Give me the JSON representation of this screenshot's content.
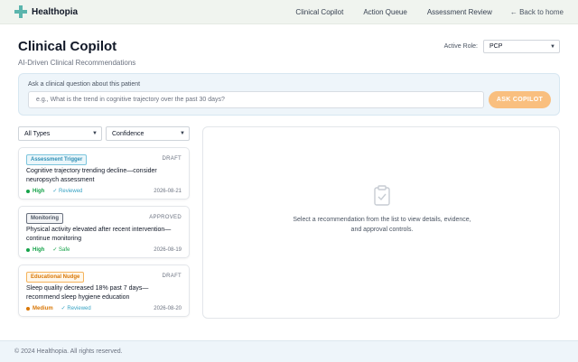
{
  "app": {
    "name": "Healthopia"
  },
  "nav": {
    "links": [
      "Clinical Copilot",
      "Action Queue",
      "Assessment Review"
    ],
    "back_label": "← Back to home"
  },
  "header": {
    "title": "Clinical Copilot",
    "subtitle": "AI-Driven Clinical Recommendations"
  },
  "role": {
    "label": "Active Role:",
    "value": "PCP"
  },
  "ask": {
    "label": "Ask a clinical question about this patient",
    "placeholder": "e.g., What is the trend in cognitive trajectory over the past 30 days?",
    "button": "ASK COPILOT"
  },
  "filters": {
    "type": "All Types",
    "confidence": "Confidence"
  },
  "recommendations": [
    {
      "tag": "Assessment Trigger",
      "status": "DRAFT",
      "text": "Cognitive trajectory trending decline—consider neuropsych assessment",
      "priority": "High",
      "review": "✓ Reviewed",
      "date": "2026-08-21"
    },
    {
      "tag": "Monitoring",
      "status": "APPROVED",
      "text": "Physical activity elevated after recent intervention—continue monitoring",
      "priority": "High",
      "review": "✓ Safe",
      "date": "2026-08-19"
    },
    {
      "tag": "Educational Nudge",
      "status": "DRAFT",
      "text": "Sleep quality decreased 18% past 7 days—recommend sleep hygiene education",
      "priority": "Medium",
      "review": "✓ Reviewed",
      "date": "2026-08-20"
    }
  ],
  "detail": {
    "empty_text": "Select a recommendation from the list to view details, evidence, and approval controls."
  },
  "footer": {
    "text": "© 2024 Healthopia. All rights reserved."
  },
  "colors": {
    "brand_teal": "#5bb5ad",
    "accent_orange": "#f9bf7f",
    "high": "#16a34a",
    "medium": "#d97706",
    "reviewed": "#38a3c4"
  },
  "icons": {
    "brand": "medical-cross-icon",
    "detail_empty": "clipboard-check-icon",
    "dropdown": "chevron-down-icon"
  }
}
